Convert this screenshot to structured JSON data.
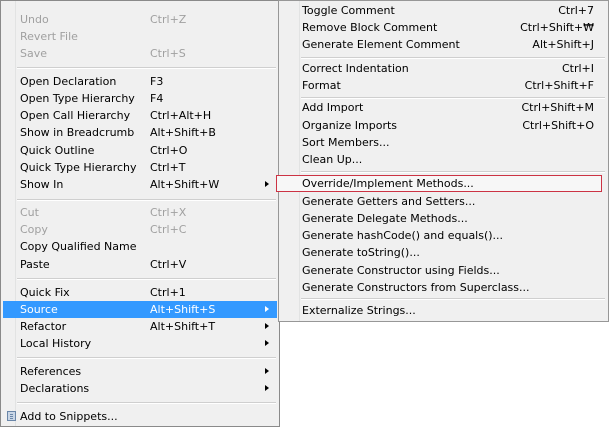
{
  "context_menu": {
    "items": [
      {
        "label": "Undo",
        "shortcut": "Ctrl+Z"
      },
      {
        "label": "Revert File",
        "shortcut": ""
      },
      {
        "label": "Save",
        "shortcut": "Ctrl+S"
      },
      {
        "label": "Open Declaration",
        "shortcut": "F3"
      },
      {
        "label": "Open Type Hierarchy",
        "shortcut": "F4"
      },
      {
        "label": "Open Call Hierarchy",
        "shortcut": "Ctrl+Alt+H"
      },
      {
        "label": "Show in Breadcrumb",
        "shortcut": "Alt+Shift+B"
      },
      {
        "label": "Quick Outline",
        "shortcut": "Ctrl+O"
      },
      {
        "label": "Quick Type Hierarchy",
        "shortcut": "Ctrl+T"
      },
      {
        "label": "Show In",
        "shortcut": "Alt+Shift+W"
      },
      {
        "label": "Cut",
        "shortcut": "Ctrl+X"
      },
      {
        "label": "Copy",
        "shortcut": "Ctrl+C"
      },
      {
        "label": "Copy Qualified Name",
        "shortcut": ""
      },
      {
        "label": "Paste",
        "shortcut": "Ctrl+V"
      },
      {
        "label": "Quick Fix",
        "shortcut": "Ctrl+1"
      },
      {
        "label": "Source",
        "shortcut": "Alt+Shift+S"
      },
      {
        "label": "Refactor",
        "shortcut": "Alt+Shift+T"
      },
      {
        "label": "Local History",
        "shortcut": ""
      },
      {
        "label": "References",
        "shortcut": ""
      },
      {
        "label": "Declarations",
        "shortcut": ""
      },
      {
        "label": "Add to Snippets...",
        "shortcut": ""
      }
    ]
  },
  "source_submenu": {
    "items": [
      {
        "label": "Toggle Comment",
        "shortcut": "Ctrl+7"
      },
      {
        "label": "Remove Block Comment",
        "shortcut": "Ctrl+Shift+₩"
      },
      {
        "label": "Generate Element Comment",
        "shortcut": "Alt+Shift+J"
      },
      {
        "label": "Correct Indentation",
        "shortcut": "Ctrl+I"
      },
      {
        "label": "Format",
        "shortcut": "Ctrl+Shift+F"
      },
      {
        "label": "Add Import",
        "shortcut": "Ctrl+Shift+M"
      },
      {
        "label": "Organize Imports",
        "shortcut": "Ctrl+Shift+O"
      },
      {
        "label": "Sort Members...",
        "shortcut": ""
      },
      {
        "label": "Clean Up...",
        "shortcut": ""
      },
      {
        "label": "Override/Implement Methods...",
        "shortcut": ""
      },
      {
        "label": "Generate Getters and Setters...",
        "shortcut": ""
      },
      {
        "label": "Generate Delegate Methods...",
        "shortcut": ""
      },
      {
        "label": "Generate hashCode() and equals()...",
        "shortcut": ""
      },
      {
        "label": "Generate toString()...",
        "shortcut": ""
      },
      {
        "label": "Generate Constructor using Fields...",
        "shortcut": ""
      },
      {
        "label": "Generate Constructors from Superclass...",
        "shortcut": ""
      },
      {
        "label": "Externalize Strings...",
        "shortcut": ""
      }
    ]
  },
  "colors": {
    "menu_background": "#f0f0f0",
    "selection": "#3399ff",
    "hover_outline": "#cc3344",
    "disabled_text": "#a0a0a0"
  }
}
